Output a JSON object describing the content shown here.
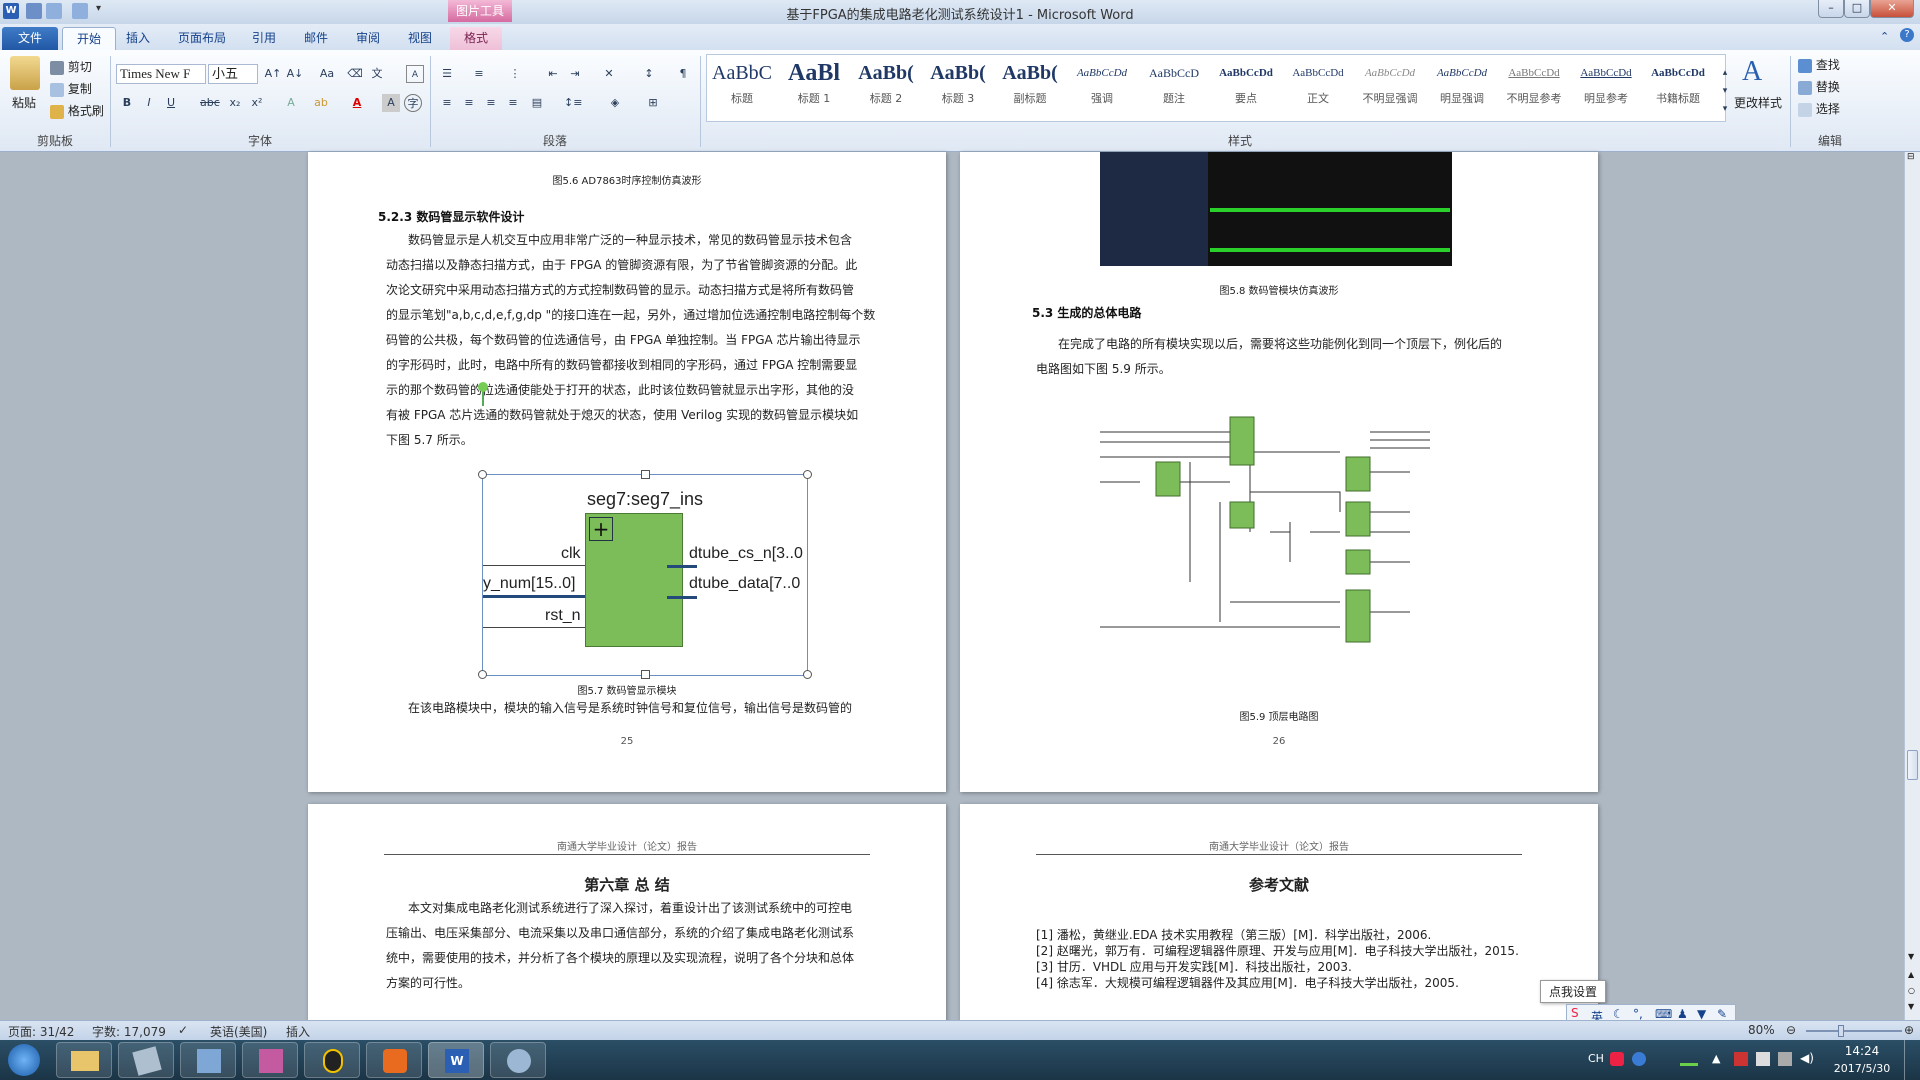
{
  "window": {
    "title": "基于FPGA的集成电路老化测试系统设计1 - Microsoft Word",
    "context_tab_header": "图片工具"
  },
  "tabs": [
    "文件",
    "开始",
    "插入",
    "页面布局",
    "引用",
    "邮件",
    "审阅",
    "视图",
    "格式"
  ],
  "ribbon": {
    "clipboard": {
      "paste": "粘贴",
      "cut": "剪切",
      "copy": "复制",
      "format_painter": "格式刷",
      "label": "剪贴板"
    },
    "font": {
      "name": "Times New F",
      "size": "小五",
      "label": "字体"
    },
    "paragraph": {
      "label": "段落"
    },
    "styles": {
      "label": "样式",
      "items": [
        {
          "sample": "AaBbC",
          "name": "标题"
        },
        {
          "sample": "AaBl",
          "name": "标题 1"
        },
        {
          "sample": "AaBb(",
          "name": "标题 2"
        },
        {
          "sample": "AaBb(",
          "name": "标题 3"
        },
        {
          "sample": "AaBb(",
          "name": "副标题"
        },
        {
          "sample": "AaBbCcDd",
          "name": "强调"
        },
        {
          "sample": "AaBbCcD",
          "name": "题注"
        },
        {
          "sample": "AaBbCcDd",
          "name": "要点"
        },
        {
          "sample": "AaBbCcDd",
          "name": "正文"
        },
        {
          "sample": "AaBbCcDd",
          "name": "不明显强调"
        },
        {
          "sample": "AaBbCcDd",
          "name": "明显强调"
        },
        {
          "sample": "AaBbCcDd",
          "name": "不明显参考"
        },
        {
          "sample": "AaBbCcDd",
          "name": "明显参考"
        },
        {
          "sample": "AaBbCcDd",
          "name": "书籍标题"
        }
      ],
      "change": "更改样式"
    },
    "editing": {
      "find": "查找",
      "replace": "替换",
      "select": "选择",
      "label": "编辑"
    }
  },
  "page25": {
    "top_caption": "图5.6 AD7863时序控制仿真波形",
    "section_heading": "5.2.3 数码管显示软件设计",
    "paragraph_lines": [
      "数码管显示是人机交互中应用非常广泛的一种显示技术，常见的数码管显示技术包含",
      "动态扫描以及静态扫描方式，由于 FPGA 的管脚资源有限，为了节省管脚资源的分配。此",
      "次论文研究中采用动态扫描方式的方式控制数码管的显示。动态扫描方式是将所有数码管",
      "的显示笔划\"a,b,c,d,e,f,g,dp \"的接口连在一起，另外，通过增加位选通控制电路控制每个数",
      "码管的公共极，每个数码管的位选通信号，由 FPGA 单独控制。当 FPGA 芯片输出待显示",
      "的字形码时，此时，电路中所有的数码管都接收到相同的字形码，通过 FPGA 控制需要显",
      "示的那个数码管的位选通使能处于打开的状态，此时该位数码管就显示出字形，其他的没",
      "有被 FPGA 芯片选通的数码管就处于熄灭的状态，使用 Verilog 实现的数码管显示模块如",
      "下图 5.7 所示。"
    ],
    "figure": {
      "title": "seg7:seg7_ins",
      "in": [
        "clk",
        "y_num[15..0]",
        "rst_n"
      ],
      "out": [
        "dtube_cs_n[3..0",
        "dtube_data[7..0"
      ]
    },
    "figure_caption": "图5.7   数码管显示模块",
    "last_line": "在该电路模块中，模块的输入信号是系统时钟信号和复位信号，输出信号是数码管的",
    "page_number": "25"
  },
  "page26": {
    "wave_caption": "图5.8   数码管模块仿真波形",
    "section_heading": "5.3   生成的总体电路",
    "paragraph_lines": [
      "在完成了电路的所有模块实现以后，需要将这些功能例化到同一个顶层下，例化后的",
      "电路图如下图 5.9 所示。"
    ],
    "figure_caption": "图5.9   顶层电路图",
    "page_number": "26"
  },
  "page_ch6": {
    "header": "南通大学毕业设计（论文）报告",
    "heading": "第六章    总    结",
    "paragraph_lines": [
      "本文对集成电路老化测试系统进行了深入探讨，着重设计出了该测试系统中的可控电",
      "压输出、电压采集部分、电流采集以及串口通信部分，系统的介绍了集成电路老化测试系",
      "统中，需要使用的技术，并分析了各个模块的原理以及实现流程，说明了各个分块和总体",
      "方案的可行性。"
    ]
  },
  "page_refs": {
    "header": "南通大学毕业设计（论文）报告",
    "heading": "参考文献",
    "refs": [
      "[1]  潘松，黄继业.EDA 技术实用教程（第三版）[M]．科学出版社，2006.",
      "[2]  赵曙光，郭万有．可编程逻辑器件原理、开发与应用[M]．电子科技大学出版社，2015.",
      "[3]  甘历．VHDL 应用与开发实践[M]．科技出版社，2003.",
      "[4]  徐志军．大规模可编程逻辑器件及其应用[M]．电子科技大学出版社，2005."
    ]
  },
  "tooltip": "点我设置",
  "status": {
    "page": "页面: 31/42",
    "words": "字数: 17,079",
    "lang": "英语(美国)",
    "mode": "插入",
    "zoom": "80%"
  },
  "ime": {
    "lang": "英",
    "lang2": "CH"
  },
  "clock": {
    "time": "14:24",
    "date": "2017/5/30"
  }
}
